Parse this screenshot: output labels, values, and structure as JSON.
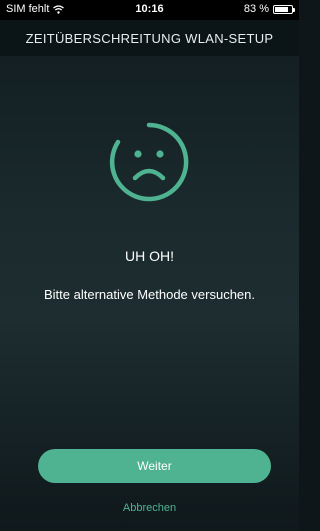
{
  "status_bar": {
    "carrier": "SIM fehlt",
    "time": "10:16",
    "battery_percent": "83 %",
    "battery_level": 0.83
  },
  "header": {
    "title": "ZEITÜBERSCHREITUNG WLAN-SETUP"
  },
  "error": {
    "icon": "sad-face-icon",
    "title": "UH OH!",
    "message": "Bitte alternative Methode versuchen."
  },
  "actions": {
    "primary_label": "Weiter",
    "cancel_label": "Abbrechen"
  },
  "colors": {
    "accent": "#4fb391",
    "background": "#1a2a2d"
  }
}
